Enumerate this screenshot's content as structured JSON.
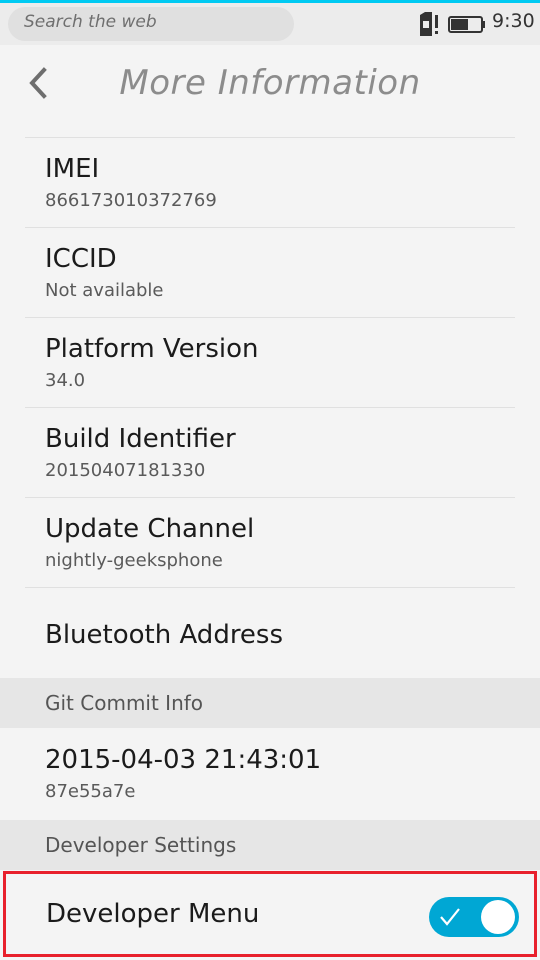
{
  "status_bar": {
    "search_placeholder": "Search the web",
    "time": "9:30",
    "icons": [
      "sim-alert-icon",
      "battery-icon"
    ]
  },
  "header": {
    "title": "More Information",
    "back_icon": "chevron-left-icon"
  },
  "info_items": [
    {
      "title": "IMEI",
      "value": "866173010372769"
    },
    {
      "title": "ICCID",
      "value": "Not available"
    },
    {
      "title": "Platform Version",
      "value": "34.0"
    },
    {
      "title": "Build Identifier",
      "value": "20150407181330"
    },
    {
      "title": "Update Channel",
      "value": "nightly-geeksphone"
    },
    {
      "title": "Bluetooth Address",
      "value": ""
    }
  ],
  "git_section": {
    "header": "Git Commit Info",
    "date": "2015-04-03 21:43:01",
    "hash": "87e55a7e"
  },
  "developer_section": {
    "header": "Developer Settings",
    "menu_label": "Developer Menu",
    "menu_enabled": true
  },
  "colors": {
    "accent": "#00caf2",
    "toggle_on": "#00a7d4",
    "highlight_border": "#e8202c"
  }
}
